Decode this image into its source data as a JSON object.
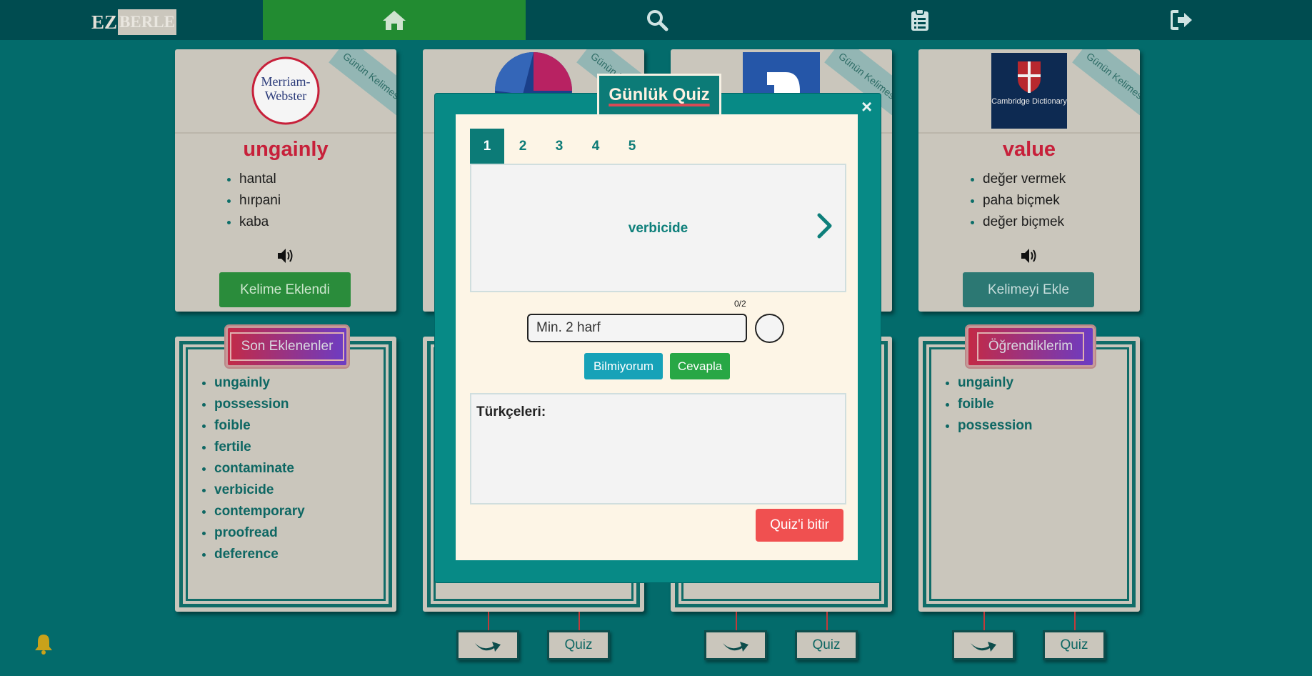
{
  "nav": {
    "logo_first": "EZ",
    "logo_rest": "BERLE",
    "icons": [
      "home-icon",
      "search-icon",
      "clipboard-icon",
      "logout-icon"
    ],
    "active_color": "#228b31"
  },
  "ribbon_text": "Günün Kelimesi",
  "cards": [
    {
      "logo_text": "Merriam-Webster",
      "word": "ungainly",
      "meanings": [
        "hantal",
        "hırpani",
        "kaba"
      ],
      "button": "Kelime Eklendi"
    },
    {
      "logo_text": "",
      "word": "",
      "meanings": [],
      "button": ""
    },
    {
      "logo_text": "",
      "word": "",
      "meanings": [],
      "button": ""
    },
    {
      "logo_text": "Cambridge Dictionary",
      "word": "value",
      "meanings": [
        "değer vermek",
        "paha biçmek",
        "değer biçmek"
      ],
      "button": "Kelimeyi Ekle"
    }
  ],
  "panels": {
    "recent": {
      "title": "Son Eklenenler",
      "items": [
        "ungainly",
        "possession",
        "foible",
        "fertile",
        "contaminate",
        "verbicide",
        "contemporary",
        "proofread",
        "deference"
      ]
    },
    "learned": {
      "title": "Öğrendiklerim",
      "items": [
        "ungainly",
        "foible",
        "possession"
      ]
    }
  },
  "bottom_buttons": {
    "quiz_label": "Quiz"
  },
  "quiz": {
    "title": "Günlük Quiz",
    "close": "×",
    "tabs": [
      "1",
      "2",
      "3",
      "4",
      "5"
    ],
    "active_tab": "1",
    "word": "verbicide",
    "counter": "0/2",
    "input_placeholder": "Min. 2 harf",
    "dont_know": "Bilmiyorum",
    "answer": "Cevapla",
    "translations_label": "Türkçeleri:",
    "finish": "Quiz'i bitir"
  }
}
